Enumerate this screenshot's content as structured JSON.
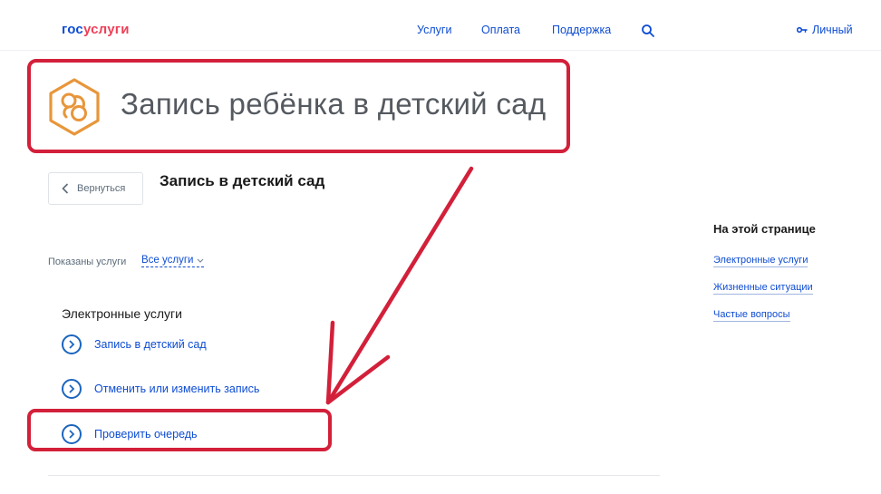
{
  "header": {
    "logo": {
      "part1": "гос",
      "part2": "услуги"
    },
    "nav": [
      "Услуги",
      "Оплата",
      "Поддержка"
    ],
    "account_label": "Личный"
  },
  "hero": {
    "title": "Запись ребёнка в детский сад",
    "icon": "baby-pacifier-icon"
  },
  "page": {
    "back_label": "Вернуться",
    "title": "Запись в детский сад"
  },
  "filter": {
    "label": "Показаны услуги",
    "selected": "Все услуги"
  },
  "services": {
    "section_title": "Электронные услуги",
    "items": [
      "Запись в детский сад",
      "Отменить или изменить запись",
      "Проверить очередь"
    ]
  },
  "aside": {
    "title": "На этой странице",
    "links": [
      "Электронные услуги",
      "Жизненные ситуации",
      "Частые вопросы"
    ]
  },
  "colors": {
    "accent": "#0d4cd3",
    "annotation_red": "#d3203a",
    "icon_orange": "#e8963a"
  }
}
